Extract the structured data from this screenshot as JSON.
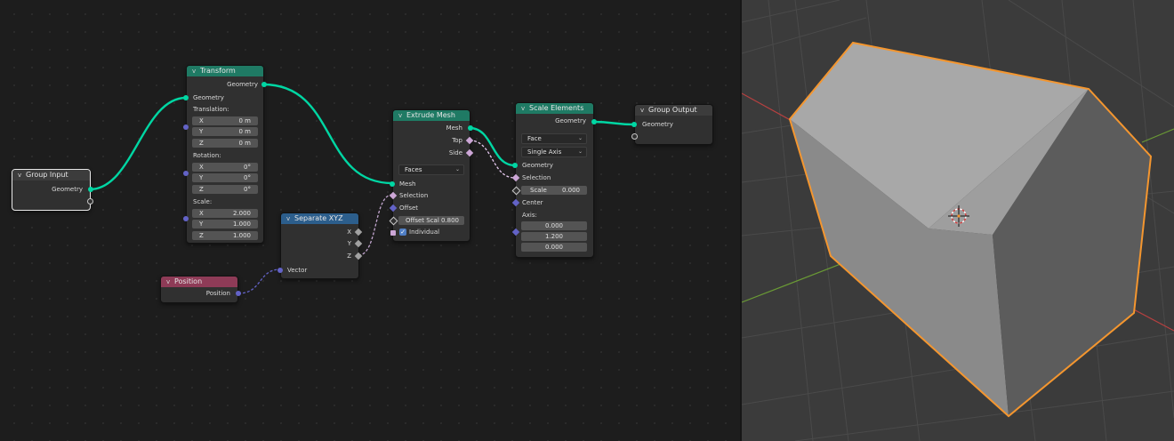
{
  "nodes": {
    "group_input": {
      "title": "Group Input",
      "outputs": {
        "geometry": "Geometry"
      }
    },
    "transform": {
      "title": "Transform",
      "outputs": {
        "geometry": "Geometry"
      },
      "inputs": {
        "geometry": "Geometry"
      },
      "translation": {
        "label": "Translation:",
        "x": {
          "axis": "X",
          "value": "0 m"
        },
        "y": {
          "axis": "Y",
          "value": "0 m"
        },
        "z": {
          "axis": "Z",
          "value": "0 m"
        }
      },
      "rotation": {
        "label": "Rotation:",
        "x": {
          "axis": "X",
          "value": "0°"
        },
        "y": {
          "axis": "Y",
          "value": "0°"
        },
        "z": {
          "axis": "Z",
          "value": "0°"
        }
      },
      "scale": {
        "label": "Scale:",
        "x": {
          "axis": "X",
          "value": "2.000"
        },
        "y": {
          "axis": "Y",
          "value": "1.000"
        },
        "z": {
          "axis": "Z",
          "value": "1.000"
        }
      }
    },
    "position": {
      "title": "Position",
      "outputs": {
        "position": "Position"
      }
    },
    "separate_xyz": {
      "title": "Separate XYZ",
      "outputs": {
        "x": "X",
        "y": "Y",
        "z": "Z"
      },
      "inputs": {
        "vector": "Vector"
      }
    },
    "extrude_mesh": {
      "title": "Extrude Mesh",
      "outputs": {
        "mesh": "Mesh",
        "top": "Top",
        "side": "Side"
      },
      "mode": "Faces",
      "inputs": {
        "mesh": "Mesh",
        "selection": "Selection",
        "offset": "Offset"
      },
      "offset_scale": {
        "label": "Offset Scal",
        "value": "0.800"
      },
      "individual": {
        "label": "Individual",
        "checked": true
      }
    },
    "scale_elements": {
      "title": "Scale Elements",
      "outputs": {
        "geometry": "Geometry"
      },
      "domain": "Face",
      "scale_mode": "Single Axis",
      "inputs": {
        "geometry": "Geometry",
        "selection": "Selection",
        "center": "Center"
      },
      "scale": {
        "label": "Scale",
        "value": "0.000"
      },
      "axis": {
        "label": "Axis:",
        "x": "0.000",
        "y": "1.200",
        "z": "0.000"
      }
    },
    "group_output": {
      "title": "Group Output",
      "inputs": {
        "geometry": "Geometry"
      }
    }
  },
  "colors": {
    "geometry_socket": "#00d6a3",
    "vector_socket": "#6363c7",
    "float_socket": "#a1a1a1",
    "bool_socket": "#cca6d6",
    "geometry_header": "#1f7a64",
    "converter_header": "#2c5e8c",
    "field_header": "#8e3b57",
    "selection_outline": "#f4962f"
  },
  "icons": {
    "collapse": "chevron-down-icon",
    "dropdown": "chevron-down-icon",
    "check": "check-icon",
    "origin": "object-origin-icon"
  }
}
